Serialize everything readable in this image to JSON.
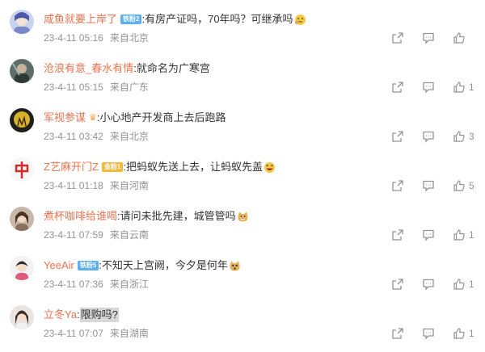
{
  "comments": [
    {
      "username": "咸鱼就要上岸了",
      "badge": "铁粉2",
      "crown": false,
      "text": "有房产证吗，70年吗？可继承吗",
      "highlight": false,
      "emoji": "thinking-emoji",
      "time": "23-4-11 05:16",
      "location": "来自北京",
      "likes": ""
    },
    {
      "username": "沧浪有意_春水有情",
      "badge": "",
      "crown": false,
      "text": "就命名为广寒宫",
      "highlight": false,
      "emoji": "",
      "time": "23-4-11 05:15",
      "location": "来自广东",
      "likes": "1"
    },
    {
      "username": "军视参谋",
      "badge": "",
      "crown": true,
      "text": "小心地产开发商上去后跑路",
      "highlight": false,
      "emoji": "",
      "time": "23-4-11 03:42",
      "location": "来自北京",
      "likes": "3"
    },
    {
      "username": "Z艺麻开门Z",
      "badge": "金粉1",
      "crown": false,
      "text": "把蚂蚁先送上去，让蚂蚁先盖",
      "highlight": false,
      "emoji": "laughing-emoji",
      "time": "23-4-11 01:18",
      "location": "来自河南",
      "likes": "5"
    },
    {
      "username": "煮杯咖啡给谁喝",
      "badge": "",
      "crown": false,
      "text": "请问未批先建，城管管吗",
      "highlight": false,
      "emoji": "doge-emoji",
      "time": "23-4-11 07:59",
      "location": "来自云南",
      "likes": "1"
    },
    {
      "username": "YeeAir",
      "badge": "铁粉5",
      "crown": false,
      "text": "不知天上宫阙，今夕是何年",
      "highlight": false,
      "emoji": "surprised-emoji",
      "time": "23-4-11 07:36",
      "location": "来自浙江",
      "likes": "1"
    },
    {
      "username": "立冬Ya",
      "badge": "",
      "crown": false,
      "text": "限购吗?",
      "highlight": true,
      "emoji": "",
      "time": "23-4-11 07:07",
      "location": "来自湖南",
      "likes": "1"
    }
  ],
  "colors": {
    "username": "#eb7350",
    "meta": "#939393",
    "text": "#333333",
    "badge_iron": "#5ab0f2",
    "badge_gold": "#f2b83c"
  }
}
